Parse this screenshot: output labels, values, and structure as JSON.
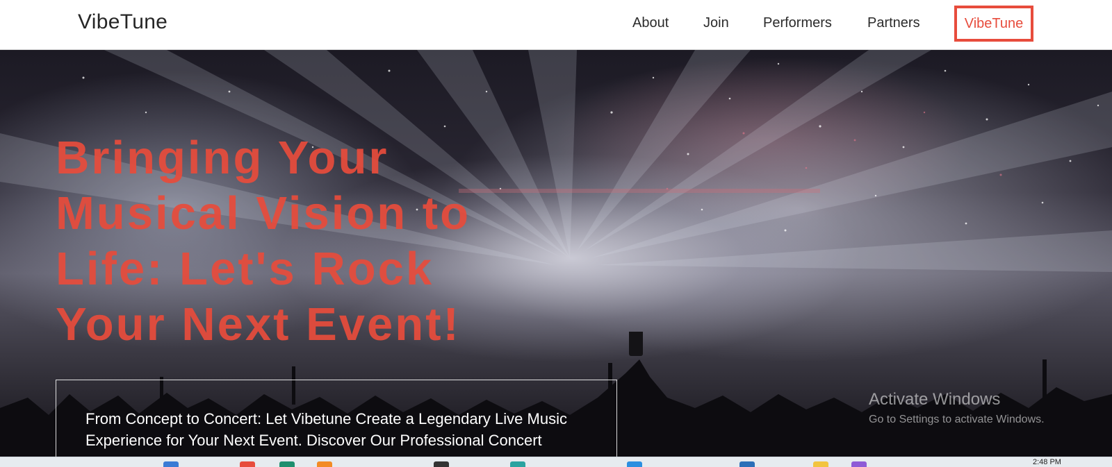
{
  "header": {
    "brand": "VibeTune",
    "nav": [
      {
        "label": "About"
      },
      {
        "label": "Join"
      },
      {
        "label": "Performers"
      },
      {
        "label": "Partners"
      }
    ],
    "cta_label": "VibeTune"
  },
  "hero": {
    "title": "Bringing Your Musical Vision to Life: Let's Rock Your Next Event!",
    "description": "From Concept to Concert: Let Vibetune Create a Legendary Live Music Experience for Your Next Event. Discover Our Professional Concert"
  },
  "watermark": {
    "title": "Activate Windows",
    "subtitle": "Go to Settings to activate Windows."
  },
  "taskbar": {
    "clock": "2:48 PM"
  },
  "colors": {
    "accent": "#e74c3c",
    "text_dark": "#262626"
  }
}
